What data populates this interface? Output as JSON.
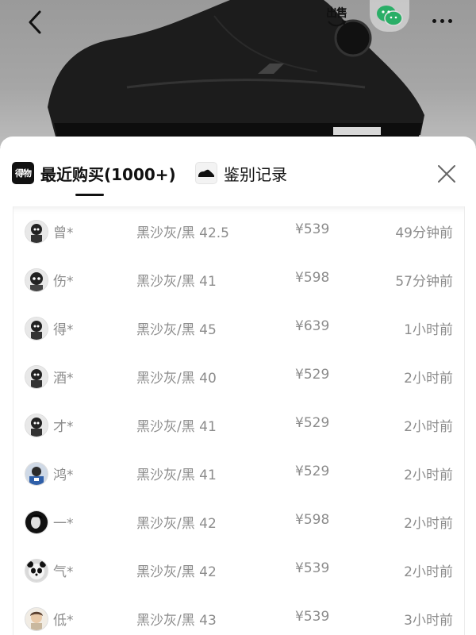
{
  "header": {
    "back_icon": "chevron-left-icon",
    "sell_label": "出售",
    "wechat_icon": "wechat-icon",
    "more_icon": "more-dots-icon"
  },
  "tabs": [
    {
      "label": "最近购买(1000+)",
      "icon": "dewu-logo-icon",
      "icon_text": "得物",
      "active": true
    },
    {
      "label": "鉴别记录",
      "icon": "sneaker-icon",
      "active": false
    }
  ],
  "close_icon": "close-icon",
  "purchases": [
    {
      "name": "曾*",
      "spec": "黑沙灰/黑 42.5",
      "price": "¥539",
      "time": "49分钟前",
      "avatar": "dark"
    },
    {
      "name": "伤*",
      "spec": "黑沙灰/黑 41",
      "price": "¥598",
      "time": "57分钟前",
      "avatar": "dark"
    },
    {
      "name": "得*",
      "spec": "黑沙灰/黑 45",
      "price": "¥639",
      "time": "1小时前",
      "avatar": "dark"
    },
    {
      "name": "酒*",
      "spec": "黑沙灰/黑 40",
      "price": "¥529",
      "time": "2小时前",
      "avatar": "dark"
    },
    {
      "name": "才*",
      "spec": "黑沙灰/黑 41",
      "price": "¥529",
      "time": "2小时前",
      "avatar": "dark"
    },
    {
      "name": "鸿*",
      "spec": "黑沙灰/黑 41",
      "price": "¥529",
      "time": "2小时前",
      "avatar": "blue"
    },
    {
      "name": "一*",
      "spec": "黑沙灰/黑 42",
      "price": "¥598",
      "time": "2小时前",
      "avatar": "black"
    },
    {
      "name": "气*",
      "spec": "黑沙灰/黑 42",
      "price": "¥539",
      "time": "2小时前",
      "avatar": "panda"
    },
    {
      "name": "低*",
      "spec": "黑沙灰/黑 43",
      "price": "¥539",
      "time": "3小时前",
      "avatar": "light"
    }
  ],
  "colors": {
    "text_primary": "#111111",
    "text_secondary": "#8c8c8c",
    "wechat_green": "#2aae67"
  }
}
